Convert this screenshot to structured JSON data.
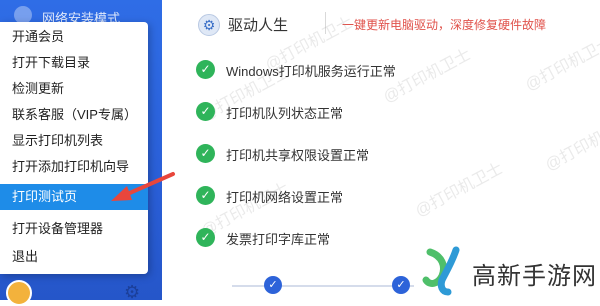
{
  "sidebar": {
    "title": "网络安装模式"
  },
  "menu": {
    "items": [
      {
        "label": "开通会员",
        "active": false
      },
      {
        "label": "打开下载目录",
        "active": false
      },
      {
        "label": "检测更新",
        "active": false
      },
      {
        "label": "联系客服（VIP专属）",
        "active": false
      },
      {
        "label": "显示打印机列表",
        "active": false
      },
      {
        "label": "打开添加打印机向导",
        "active": false
      },
      {
        "label": "打印测试页",
        "active": true
      },
      {
        "label": "打开设备管理器",
        "active": false
      },
      {
        "label": "退出",
        "active": false
      }
    ]
  },
  "header": {
    "title": "驱动人生",
    "description": "一键更新电脑驱动，深度修复硬件故障",
    "icon": "gear-icon"
  },
  "checks": [
    {
      "label": "Windows打印机服务运行正常",
      "status": "ok"
    },
    {
      "label": "打印机队列状态正常",
      "status": "ok"
    },
    {
      "label": "打印机共享权限设置正常",
      "status": "ok"
    },
    {
      "label": "打印机网络设置正常",
      "status": "ok"
    },
    {
      "label": "发票打印字库正常",
      "status": "ok"
    }
  ],
  "watermark": "@打印机卫士",
  "logo": {
    "text": "高新手游网"
  },
  "colors": {
    "accent": "#1e8ce8",
    "sidebar": "#2f6de6",
    "success": "#2fb45a",
    "warning_text": "#e0524b",
    "arrow": "#e8463c"
  }
}
